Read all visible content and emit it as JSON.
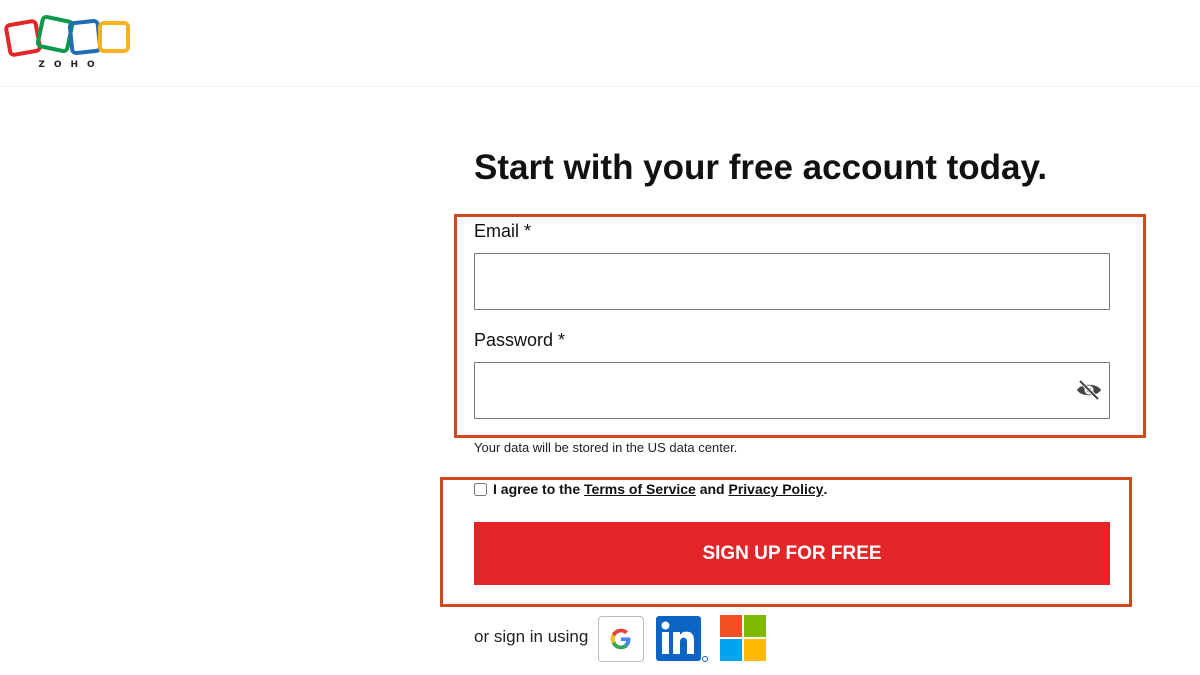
{
  "brand": {
    "logo_text": "ZOHO",
    "colors": {
      "red": "#e42527",
      "green": "#089949",
      "blue": "#226db4",
      "yellow": "#f9b21d"
    }
  },
  "page": {
    "headline": "Start with your free account today."
  },
  "form": {
    "email_label": "Email *",
    "email_value": "",
    "password_label": "Password *",
    "password_value": "",
    "data_center_note": "Your data will be stored in the US data center.",
    "agree_prefix": "I agree to the",
    "terms_link": "Terms of Service",
    "agree_and": "and",
    "privacy_link": "Privacy Policy",
    "agree_suffix": ".",
    "agree_checked": false,
    "submit_label": "SIGN UP FOR FREE"
  },
  "social": {
    "label": "or sign in using",
    "providers": [
      {
        "name": "Google",
        "icon": "google-icon"
      },
      {
        "name": "LinkedIn",
        "icon": "linkedin-icon"
      },
      {
        "name": "Microsoft",
        "icon": "microsoft-icon"
      }
    ]
  },
  "colors": {
    "accent_red": "#e42527",
    "highlight_outline": "#cf4a1c"
  }
}
